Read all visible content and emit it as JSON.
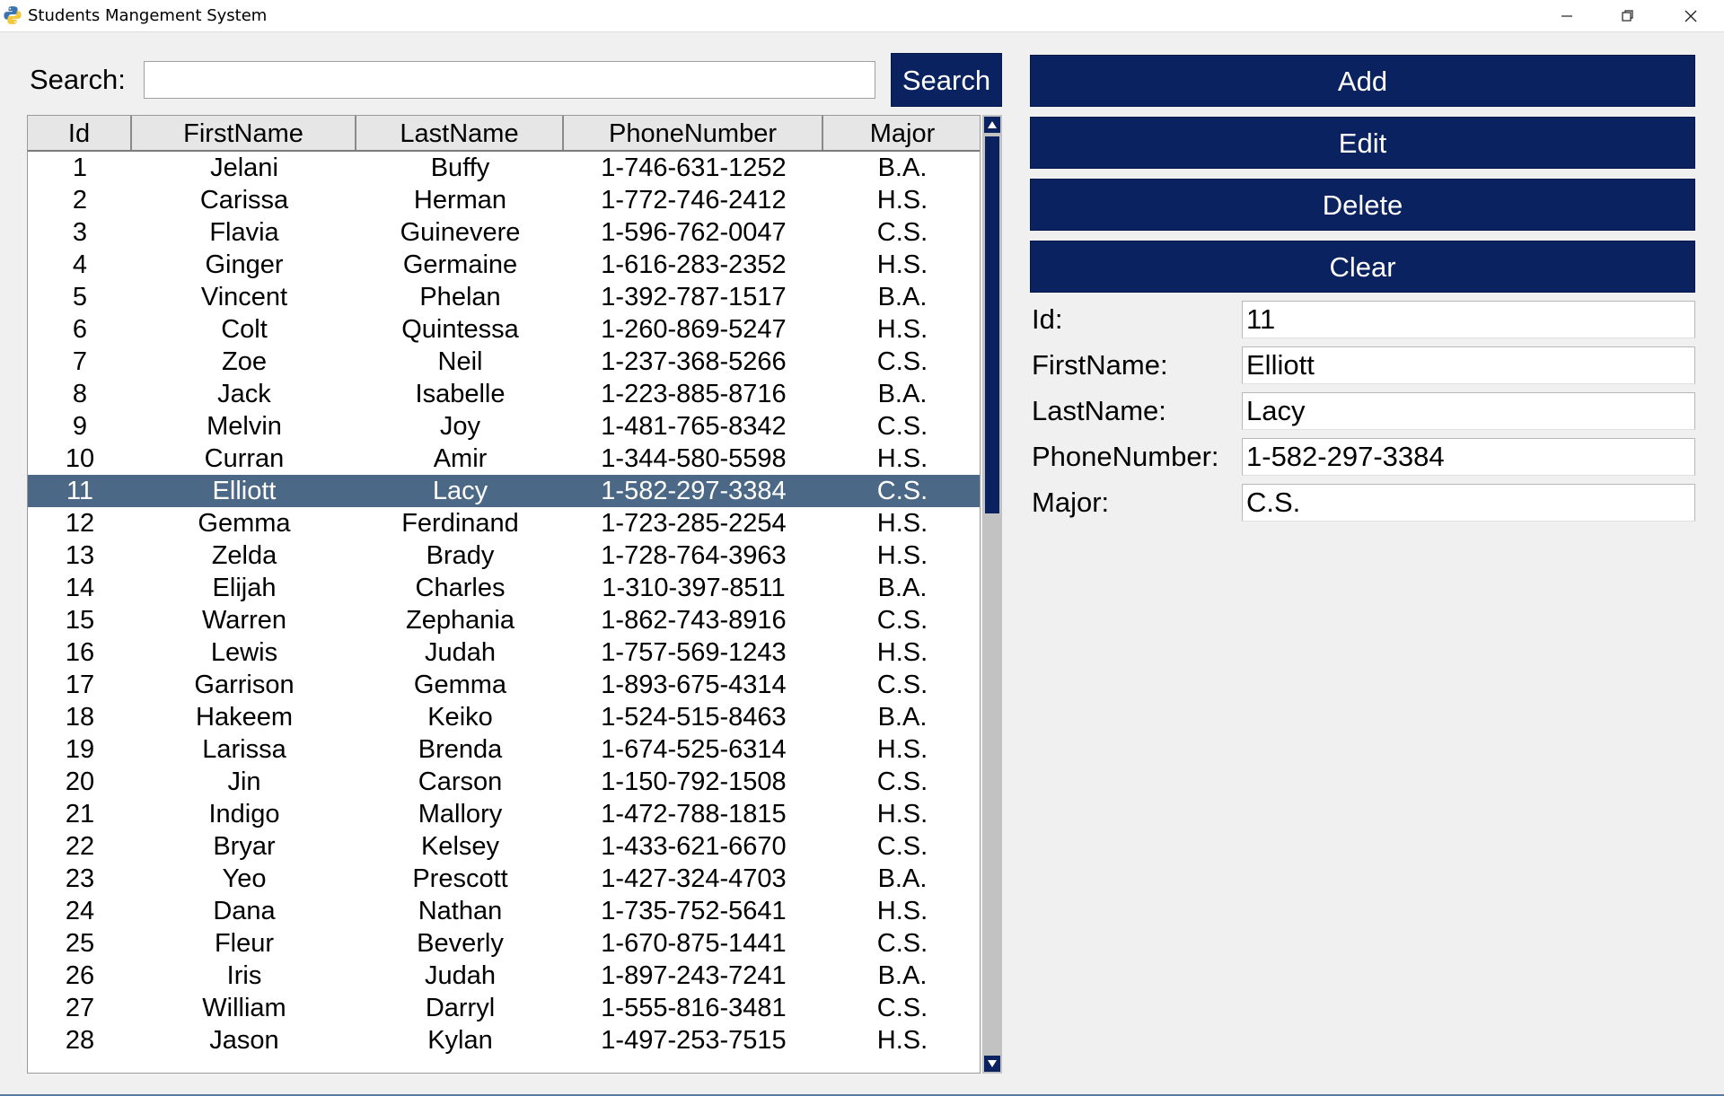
{
  "window": {
    "title": "Students Mangement System",
    "icons": {
      "app": "python-icon",
      "minimize": "minimize-icon",
      "maximize": "restore-icon",
      "close": "close-icon"
    }
  },
  "search": {
    "label": "Search:",
    "value": "",
    "button_label": "Search"
  },
  "table": {
    "columns": [
      "Id",
      "FirstName",
      "LastName",
      "PhoneNumber",
      "Major"
    ],
    "selected_index": 10,
    "rows": [
      [
        "1",
        "Jelani",
        "Buffy",
        "1-746-631-1252",
        "B.A."
      ],
      [
        "2",
        "Carissa",
        "Herman",
        "1-772-746-2412",
        "H.S."
      ],
      [
        "3",
        "Flavia",
        "Guinevere",
        "1-596-762-0047",
        "C.S."
      ],
      [
        "4",
        "Ginger",
        "Germaine",
        "1-616-283-2352",
        "H.S."
      ],
      [
        "5",
        "Vincent",
        "Phelan",
        "1-392-787-1517",
        "B.A."
      ],
      [
        "6",
        "Colt",
        "Quintessa",
        "1-260-869-5247",
        "H.S."
      ],
      [
        "7",
        "Zoe",
        "Neil",
        "1-237-368-5266",
        "C.S."
      ],
      [
        "8",
        "Jack",
        "Isabelle",
        "1-223-885-8716",
        "B.A."
      ],
      [
        "9",
        "Melvin",
        "Joy",
        "1-481-765-8342",
        "C.S."
      ],
      [
        "10",
        "Curran",
        "Amir",
        "1-344-580-5598",
        "H.S."
      ],
      [
        "11",
        "Elliott",
        "Lacy",
        "1-582-297-3384",
        "C.S."
      ],
      [
        "12",
        "Gemma",
        "Ferdinand",
        "1-723-285-2254",
        "H.S."
      ],
      [
        "13",
        "Zelda",
        "Brady",
        "1-728-764-3963",
        "H.S."
      ],
      [
        "14",
        "Elijah",
        "Charles",
        "1-310-397-8511",
        "B.A."
      ],
      [
        "15",
        "Warren",
        "Zephania",
        "1-862-743-8916",
        "C.S."
      ],
      [
        "16",
        "Lewis",
        "Judah",
        "1-757-569-1243",
        "H.S."
      ],
      [
        "17",
        "Garrison",
        "Gemma",
        "1-893-675-4314",
        "C.S."
      ],
      [
        "18",
        "Hakeem",
        "Keiko",
        "1-524-515-8463",
        "B.A."
      ],
      [
        "19",
        "Larissa",
        "Brenda",
        "1-674-525-6314",
        "H.S."
      ],
      [
        "20",
        "Jin",
        "Carson",
        "1-150-792-1508",
        "C.S."
      ],
      [
        "21",
        "Indigo",
        "Mallory",
        "1-472-788-1815",
        "H.S."
      ],
      [
        "22",
        "Bryar",
        "Kelsey",
        "1-433-621-6670",
        "C.S."
      ],
      [
        "23",
        "Yeo",
        "Prescott",
        "1-427-324-4703",
        "B.A."
      ],
      [
        "24",
        "Dana",
        "Nathan",
        "1-735-752-5641",
        "H.S."
      ],
      [
        "25",
        "Fleur",
        "Beverly",
        "1-670-875-1441",
        "C.S."
      ],
      [
        "26",
        "Iris",
        "Judah",
        "1-897-243-7241",
        "B.A."
      ],
      [
        "27",
        "William",
        "Darryl",
        "1-555-816-3481",
        "C.S."
      ],
      [
        "28",
        "Jason",
        "Kylan",
        "1-497-253-7515",
        "H.S."
      ]
    ]
  },
  "actions": {
    "add": "Add",
    "edit": "Edit",
    "delete": "Delete",
    "clear": "Clear"
  },
  "form": {
    "id_label": "Id:",
    "id_value": "11",
    "firstname_label": "FirstName:",
    "firstname_value": "Elliott",
    "lastname_label": "LastName:",
    "lastname_value": "Lacy",
    "phone_label": "PhoneNumber:",
    "phone_value": "1-582-297-3384",
    "major_label": "Major:",
    "major_value": "C.S."
  },
  "colors": {
    "button_bg": "#0b2260",
    "selected_row_bg": "#4b6987",
    "window_bg": "#f0f0f0"
  }
}
